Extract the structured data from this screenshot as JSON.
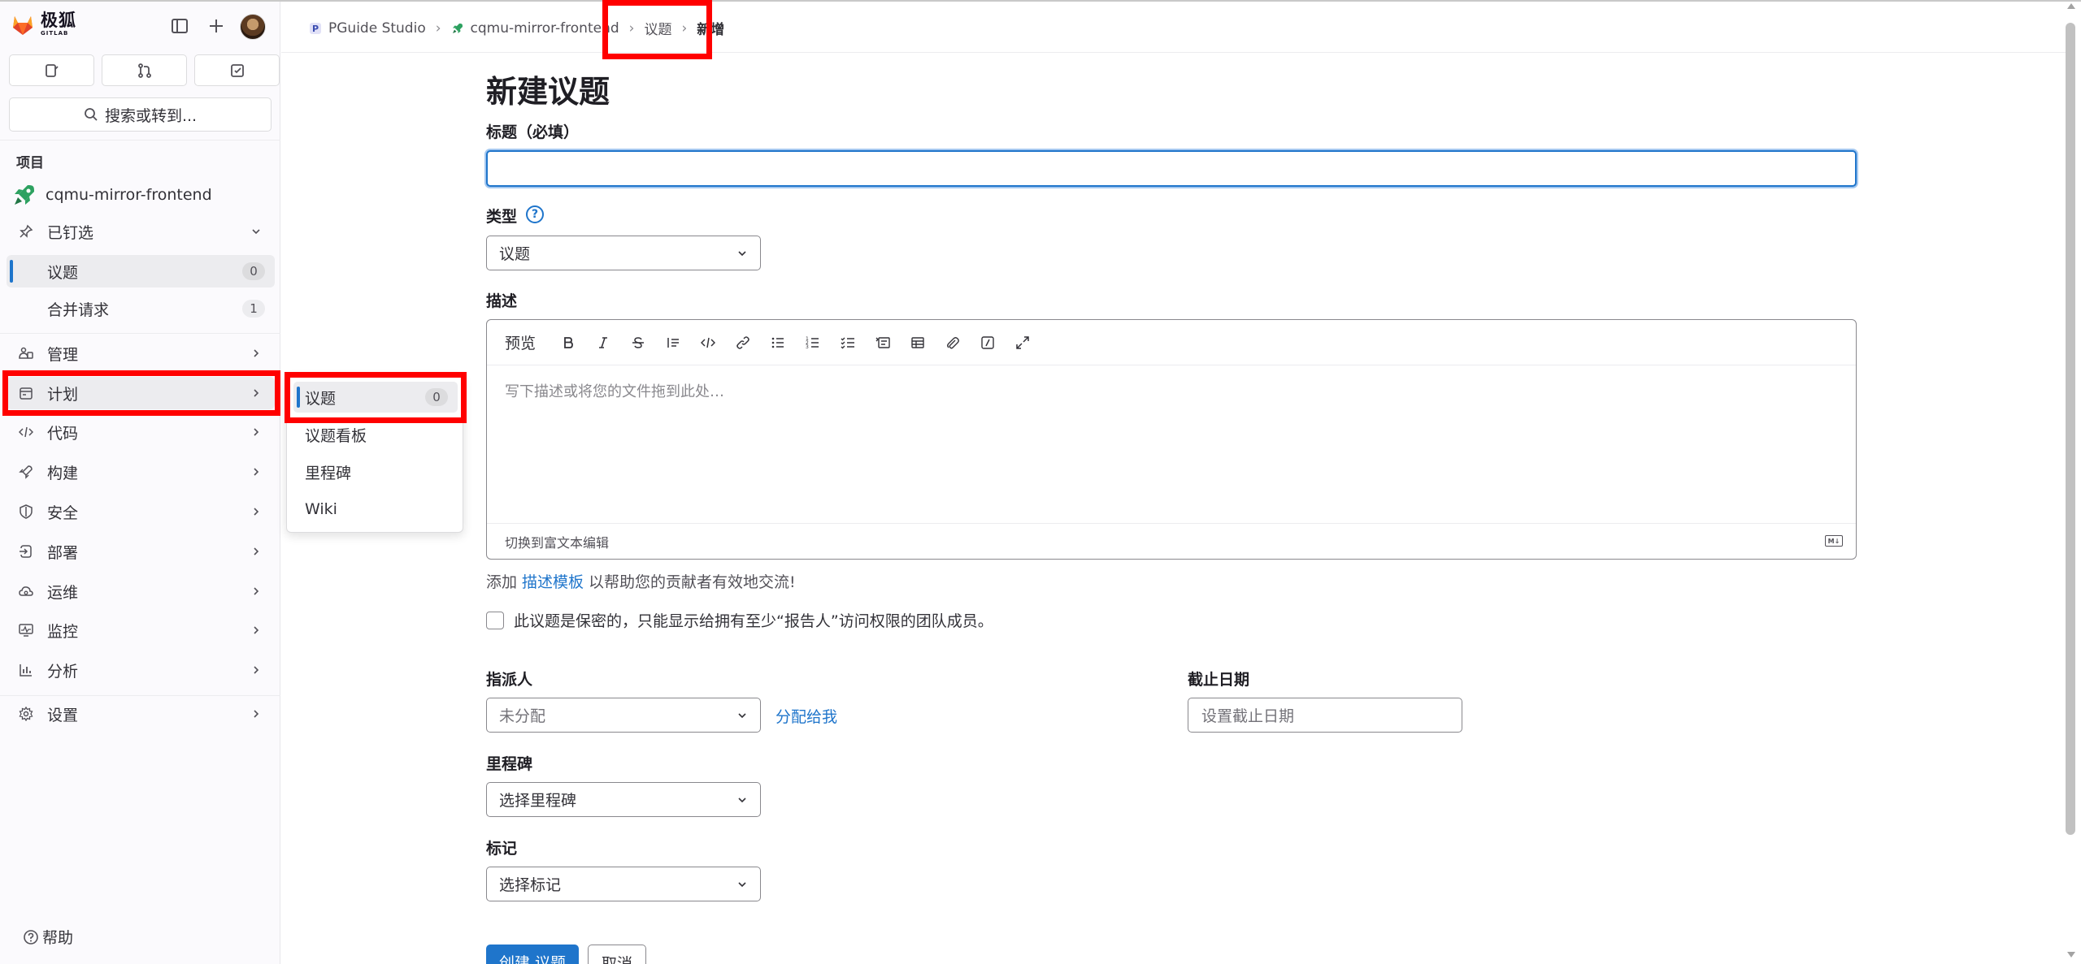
{
  "brand": {
    "name": "极狐",
    "sub": "GITLAB"
  },
  "sidebar": {
    "search_label": "搜索或转到...",
    "section_label": "项目",
    "project_name": "cqmu-mirror-frontend",
    "pinned": {
      "label": "已钉选",
      "items": [
        {
          "label": "议题",
          "count": "0"
        },
        {
          "label": "合并请求",
          "count": "1"
        }
      ]
    },
    "items": [
      {
        "label": "管理"
      },
      {
        "label": "计划"
      },
      {
        "label": "代码"
      },
      {
        "label": "构建"
      },
      {
        "label": "安全"
      },
      {
        "label": "部署"
      },
      {
        "label": "运维"
      },
      {
        "label": "监控"
      },
      {
        "label": "分析"
      },
      {
        "label": "设置"
      }
    ],
    "help_label": "帮助"
  },
  "flyout": {
    "items": [
      {
        "label": "议题",
        "count": "0"
      },
      {
        "label": "议题看板"
      },
      {
        "label": "里程碑"
      },
      {
        "label": "Wiki"
      }
    ]
  },
  "breadcrumbs": [
    "PGuide Studio",
    "cqmu-mirror-frontend",
    "议题",
    "新增"
  ],
  "form": {
    "page_title": "新建议题",
    "title_label": "标题（必填）",
    "title_value": "",
    "type_label": "类型",
    "type_value": "议题",
    "description_label": "描述",
    "preview_label": "预览",
    "description_placeholder": "写下描述或将您的文件拖到此处…",
    "rich_text_toggle": "切换到富文本编辑",
    "template_prefix": "添加",
    "template_link": "描述模板",
    "template_suffix": "以帮助您的贡献者有效地交流!",
    "confidential_label": "此议题是保密的，只能显示给拥有至少“报告人”访问权限的团队成员。",
    "assignee_label": "指派人",
    "assignee_value": "未分配",
    "assign_to_me": "分配给我",
    "due_date_label": "截止日期",
    "due_date_placeholder": "设置截止日期",
    "milestone_label": "里程碑",
    "milestone_value": "选择里程碑",
    "labels_label": "标记",
    "labels_value": "选择标记",
    "submit_label": "创建 议题",
    "cancel_label": "取消"
  },
  "colors": {
    "accent": "#1f75cb",
    "highlight": "#ff0000",
    "brand_orange": "#e24329"
  }
}
